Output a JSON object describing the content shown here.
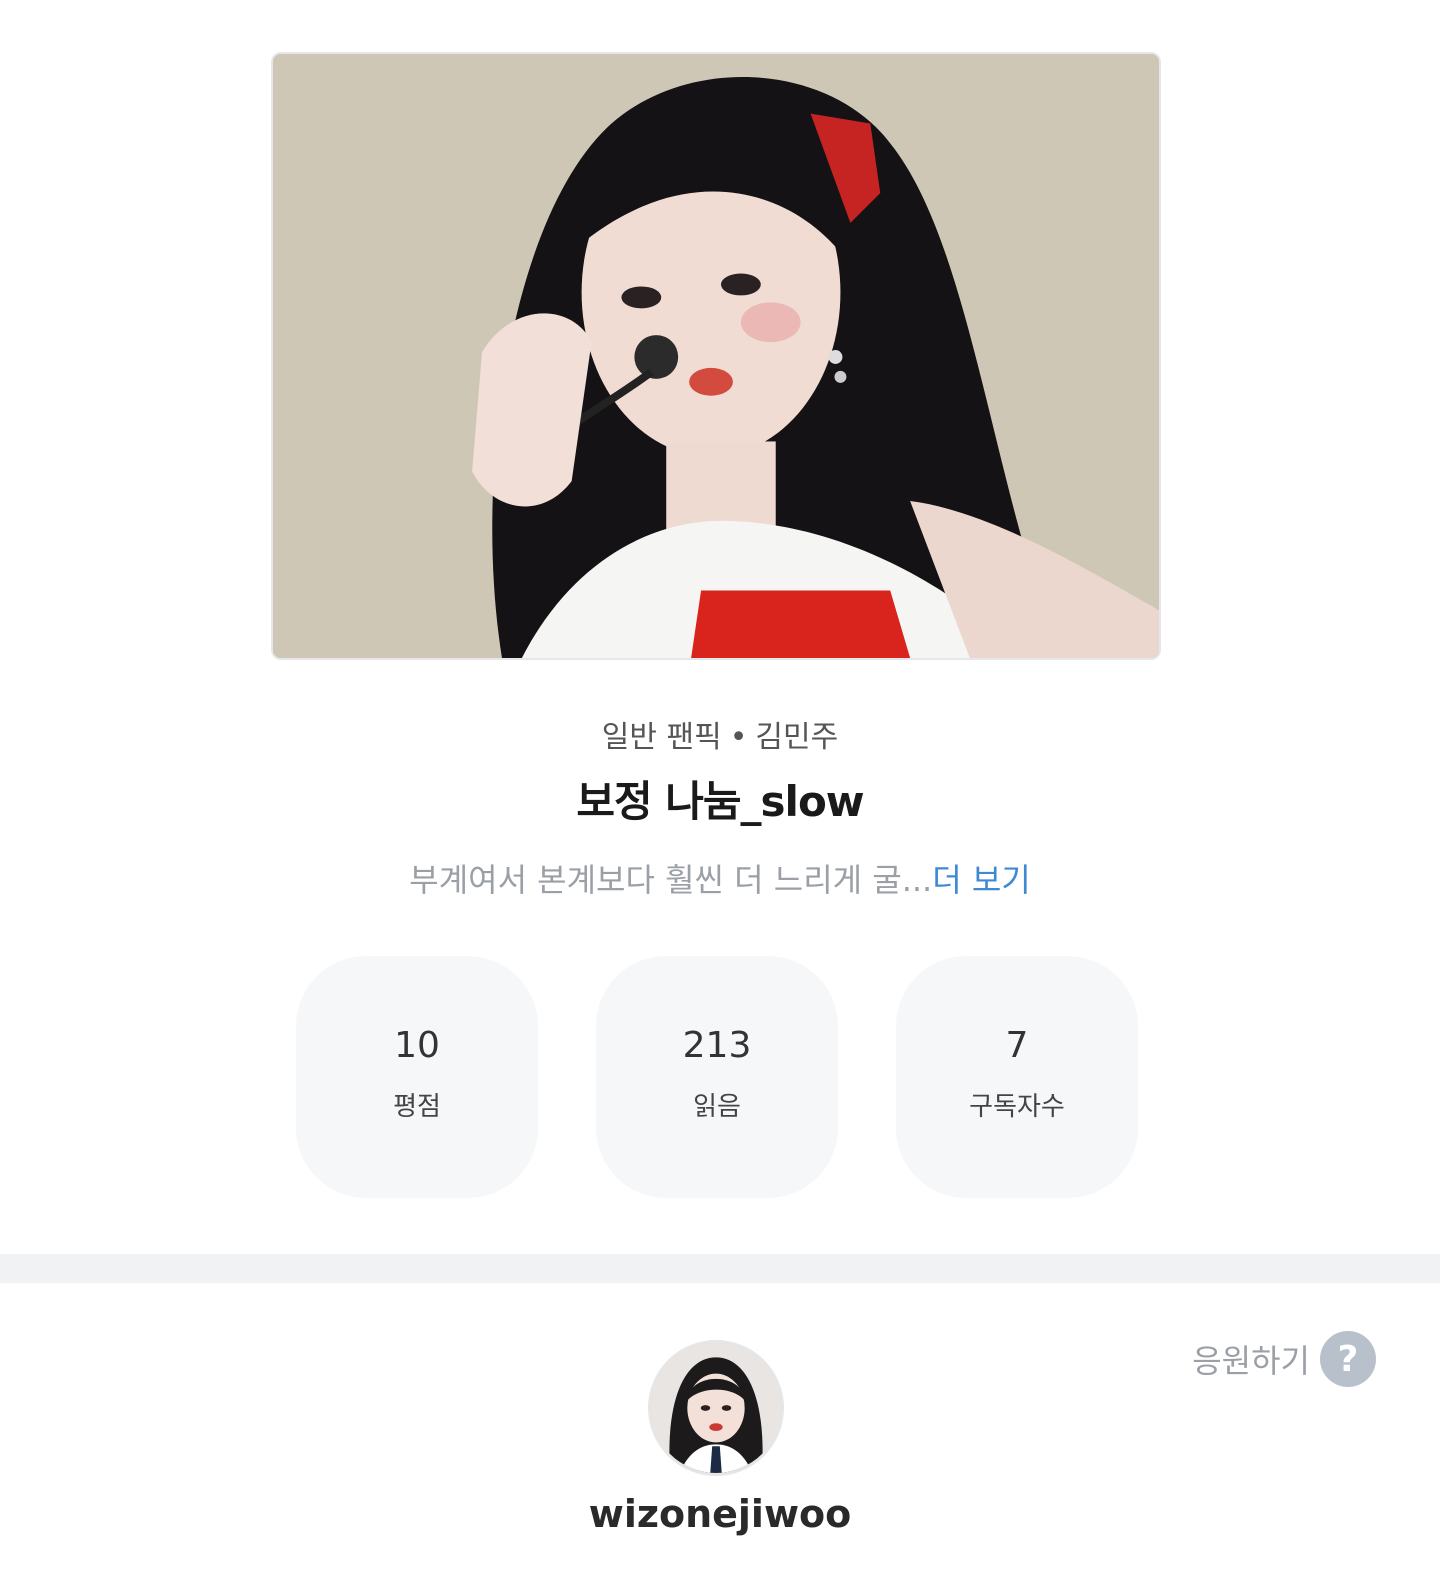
{
  "work": {
    "cover_alt": "cover image",
    "genre": "일반 팬픽",
    "separator": "•",
    "character": "김민주",
    "title": "보정 나눔_slow",
    "description": "부계여서 본계보다 훨씬 더 느리게 굴...",
    "more_label": "더 보기"
  },
  "stats": [
    {
      "value": "10",
      "label": "평점"
    },
    {
      "value": "213",
      "label": "읽음"
    },
    {
      "value": "7",
      "label": "구독자수"
    }
  ],
  "cheer": {
    "label": "응원하기",
    "help_glyph": "?"
  },
  "author": {
    "username": "wizonejiwoo"
  },
  "colors": {
    "link": "#3d8ad4",
    "muted": "#9aa0a6",
    "stat_bg": "#f6f7f9",
    "divider": "#f1f2f4"
  }
}
